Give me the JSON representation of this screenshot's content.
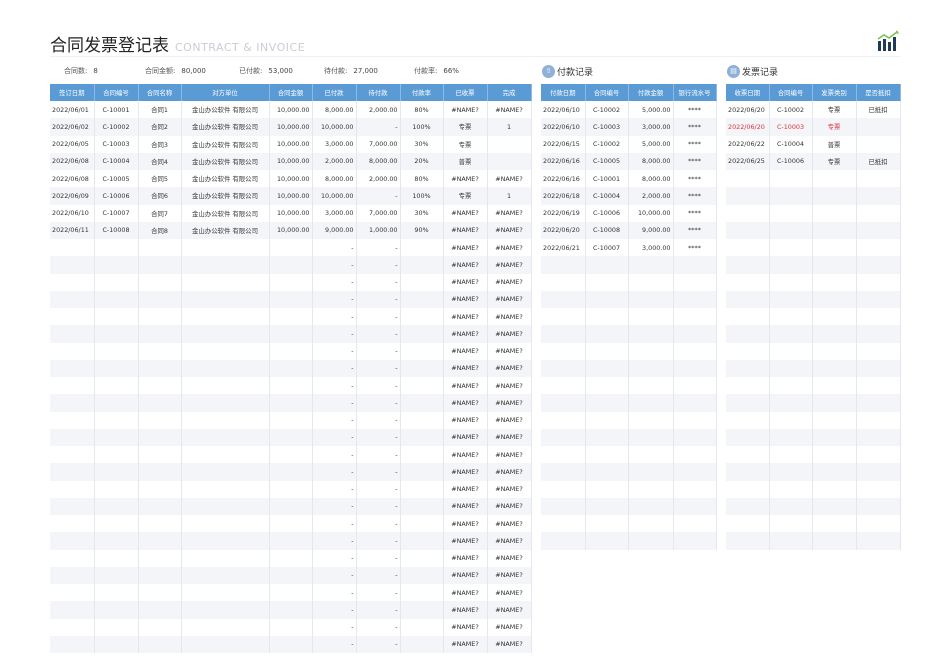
{
  "header": {
    "title": "合同发票登记表",
    "subtitle": "CONTRACT & INVOICE"
  },
  "summary": {
    "contract_count_label": "合同数:",
    "contract_count": "8",
    "contract_amount_label": "合同金额:",
    "contract_amount": "80,000",
    "paid_label": "已付款:",
    "paid": "53,000",
    "pending_label": "待付款:",
    "pending": "27,000",
    "pay_rate_label": "付款率:",
    "pay_rate": "66%"
  },
  "sections": {
    "payment_title": "付款记录",
    "invoice_title": "发票记录"
  },
  "contracts": {
    "columns": [
      "签订日期",
      "合同编号",
      "合同名称",
      "对方单位",
      "合同金额",
      "已付款",
      "待付款",
      "付款率",
      "已收票",
      "完成"
    ],
    "rows": [
      [
        "2022/06/01",
        "C-10001",
        "合同1",
        "金山办公软件 有限公司",
        "10,000.00",
        "8,000.00",
        "2,000.00",
        "80%",
        "#NAME?",
        "#NAME?"
      ],
      [
        "2022/06/02",
        "C-10002",
        "合同2",
        "金山办公软件 有限公司",
        "10,000.00",
        "10,000.00",
        "-",
        "100%",
        "专票",
        "1"
      ],
      [
        "2022/06/05",
        "C-10003",
        "合同3",
        "金山办公软件 有限公司",
        "10,000.00",
        "3,000.00",
        "7,000.00",
        "30%",
        "专票",
        ""
      ],
      [
        "2022/06/08",
        "C-10004",
        "合同4",
        "金山办公软件 有限公司",
        "10,000.00",
        "2,000.00",
        "8,000.00",
        "20%",
        "普票",
        ""
      ],
      [
        "2022/06/08",
        "C-10005",
        "合同5",
        "金山办公软件 有限公司",
        "10,000.00",
        "8,000.00",
        "2,000.00",
        "80%",
        "#NAME?",
        "#NAME?"
      ],
      [
        "2022/06/09",
        "C-10006",
        "合同6",
        "金山办公软件 有限公司",
        "10,000.00",
        "10,000.00",
        "-",
        "100%",
        "专票",
        "1"
      ],
      [
        "2022/06/10",
        "C-10007",
        "合同7",
        "金山办公软件 有限公司",
        "10,000.00",
        "3,000.00",
        "7,000.00",
        "30%",
        "#NAME?",
        "#NAME?"
      ],
      [
        "2022/06/11",
        "C-10008",
        "合同8",
        "金山办公软件 有限公司",
        "10,000.00",
        "9,000.00",
        "1,000.00",
        "90%",
        "#NAME?",
        "#NAME?"
      ],
      [
        "",
        "",
        "",
        "",
        "",
        "-",
        "-",
        "",
        "#NAME?",
        "#NAME?"
      ],
      [
        "",
        "",
        "",
        "",
        "",
        "-",
        "-",
        "",
        "#NAME?",
        "#NAME?"
      ],
      [
        "",
        "",
        "",
        "",
        "",
        "-",
        "-",
        "",
        "#NAME?",
        "#NAME?"
      ],
      [
        "",
        "",
        "",
        "",
        "",
        "-",
        "-",
        "",
        "#NAME?",
        "#NAME?"
      ],
      [
        "",
        "",
        "",
        "",
        "",
        "-",
        "-",
        "",
        "#NAME?",
        "#NAME?"
      ],
      [
        "",
        "",
        "",
        "",
        "",
        "-",
        "-",
        "",
        "#NAME?",
        "#NAME?"
      ],
      [
        "",
        "",
        "",
        "",
        "",
        "-",
        "-",
        "",
        "#NAME?",
        "#NAME?"
      ],
      [
        "",
        "",
        "",
        "",
        "",
        "-",
        "-",
        "",
        "#NAME?",
        "#NAME?"
      ],
      [
        "",
        "",
        "",
        "",
        "",
        "-",
        "-",
        "",
        "#NAME?",
        "#NAME?"
      ],
      [
        "",
        "",
        "",
        "",
        "",
        "-",
        "-",
        "",
        "#NAME?",
        "#NAME?"
      ],
      [
        "",
        "",
        "",
        "",
        "",
        "-",
        "-",
        "",
        "#NAME?",
        "#NAME?"
      ],
      [
        "",
        "",
        "",
        "",
        "",
        "-",
        "-",
        "",
        "#NAME?",
        "#NAME?"
      ],
      [
        "",
        "",
        "",
        "",
        "",
        "-",
        "-",
        "",
        "#NAME?",
        "#NAME?"
      ],
      [
        "",
        "",
        "",
        "",
        "",
        "-",
        "-",
        "",
        "#NAME?",
        "#NAME?"
      ],
      [
        "",
        "",
        "",
        "",
        "",
        "-",
        "-",
        "",
        "#NAME?",
        "#NAME?"
      ],
      [
        "",
        "",
        "",
        "",
        "",
        "-",
        "-",
        "",
        "#NAME?",
        "#NAME?"
      ],
      [
        "",
        "",
        "",
        "",
        "",
        "-",
        "-",
        "",
        "#NAME?",
        "#NAME?"
      ],
      [
        "",
        "",
        "",
        "",
        "",
        "-",
        "-",
        "",
        "#NAME?",
        "#NAME?"
      ],
      [
        "",
        "",
        "",
        "",
        "",
        "-",
        "-",
        "",
        "#NAME?",
        "#NAME?"
      ],
      [
        "",
        "",
        "",
        "",
        "",
        "-",
        "-",
        "",
        "#NAME?",
        "#NAME?"
      ],
      [
        "",
        "",
        "",
        "",
        "",
        "-",
        "-",
        "",
        "#NAME?",
        "#NAME?"
      ],
      [
        "",
        "",
        "",
        "",
        "",
        "-",
        "-",
        "",
        "#NAME?",
        "#NAME?"
      ],
      [
        "",
        "",
        "",
        "",
        "",
        "-",
        "-",
        "",
        "#NAME?",
        "#NAME?"
      ],
      [
        "",
        "",
        "",
        "",
        "",
        "-",
        "-",
        "",
        "#NAME?",
        "#NAME?"
      ]
    ]
  },
  "payments": {
    "columns": [
      "付款日期",
      "合同编号",
      "付款金额",
      "银行流水号"
    ],
    "rows": [
      [
        "2022/06/10",
        "C-10002",
        "5,000.00",
        "****"
      ],
      [
        "2022/06/10",
        "C-10003",
        "3,000.00",
        "****"
      ],
      [
        "2022/06/15",
        "C-10002",
        "5,000.00",
        "****"
      ],
      [
        "2022/06/16",
        "C-10005",
        "8,000.00",
        "****"
      ],
      [
        "2022/06/16",
        "C-10001",
        "8,000.00",
        "****"
      ],
      [
        "2022/06/18",
        "C-10004",
        "2,000.00",
        "****"
      ],
      [
        "2022/06/19",
        "C-10006",
        "10,000.00",
        "****"
      ],
      [
        "2022/06/20",
        "C-10008",
        "9,000.00",
        "****"
      ],
      [
        "2022/06/21",
        "C-10007",
        "3,000.00",
        "****"
      ]
    ]
  },
  "invoices": {
    "columns": [
      "收票日期",
      "合同编号",
      "发票类别",
      "是否抵扣"
    ],
    "rows": [
      [
        "2022/06/20",
        "C-10002",
        "专票",
        "已抵扣"
      ],
      [
        "2022/06/20",
        "C-10003",
        "专票",
        ""
      ],
      [
        "2022/06/22",
        "C-10004",
        "普票",
        ""
      ],
      [
        "2022/06/25",
        "C-10006",
        "专票",
        "已抵扣"
      ]
    ],
    "highlight_row": 1
  },
  "colors": {
    "header_blue": "#5b9bd5",
    "highlight_red": "#e0303a",
    "stripe": "#f3f5f8"
  }
}
